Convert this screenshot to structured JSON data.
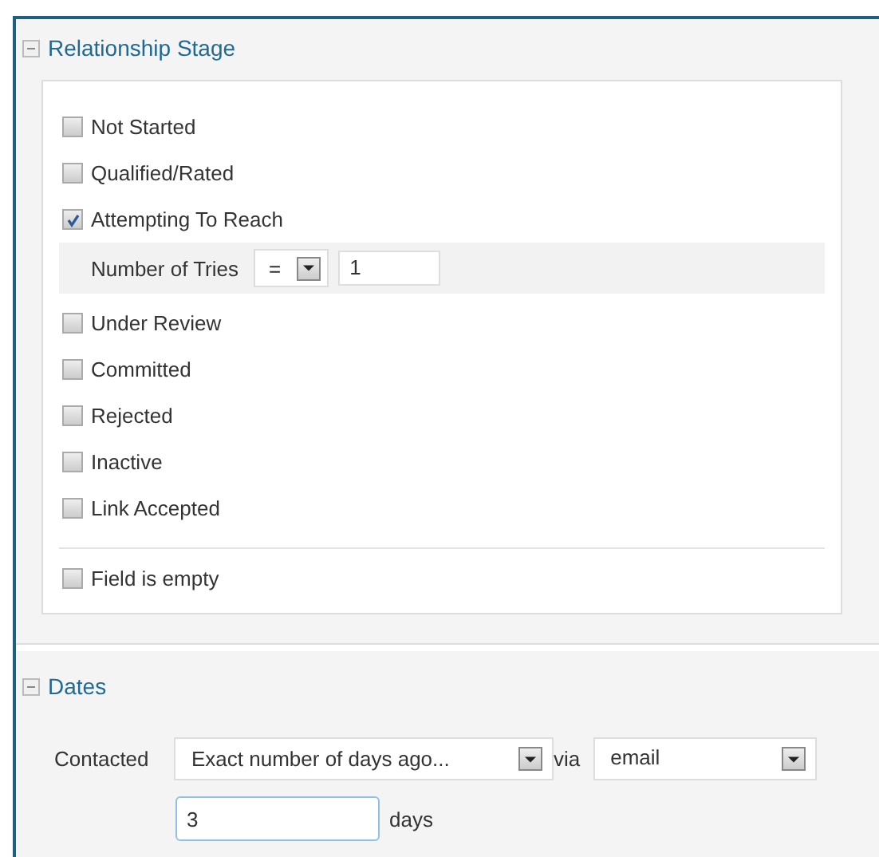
{
  "sections": [
    {
      "title": "Relationship Stage",
      "expanded": true,
      "options": [
        {
          "label": "Not Started",
          "checked": false
        },
        {
          "label": "Qualified/Rated",
          "checked": false
        },
        {
          "label": "Attempting To Reach",
          "checked": true,
          "sub_filter": {
            "label": "Number of Tries",
            "operator": "=",
            "value": "1"
          }
        },
        {
          "label": "Under Review",
          "checked": false
        },
        {
          "label": "Committed",
          "checked": false
        },
        {
          "label": "Rejected",
          "checked": false
        },
        {
          "label": "Inactive",
          "checked": false
        },
        {
          "label": "Link Accepted",
          "checked": false
        }
      ],
      "empty_option": {
        "label": "Field is empty",
        "checked": false
      }
    },
    {
      "title": "Dates",
      "expanded": true,
      "contacted": {
        "label": "Contacted",
        "mode": "Exact number of days ago...",
        "via_label": "via",
        "via": "email",
        "days_value": "3",
        "days_label": "days"
      }
    }
  ]
}
